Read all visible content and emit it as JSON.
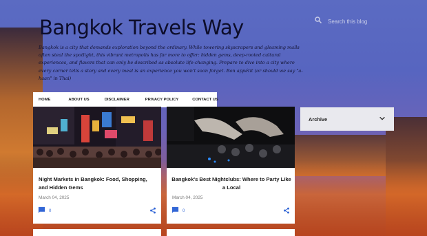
{
  "search": {
    "placeholder": "Search this blog",
    "icon": "search-icon"
  },
  "blog": {
    "title": "Bangkok Travels Way",
    "description": "Bangkok is a city that demands exploration beyond the ordinary. While towering skyscrapers and gleaming malls often steal the spotlight, this vibrant metropolis has far more to offer: hidden gems, deep-rooted cultural experiences, and flavors that can only be described as absolute life-changing. Prepare to dive into a city where every corner tells a story and every meal is an experience you won't soon forget. Bon appétit (or should we say \"a-haan\" in Thai)"
  },
  "nav": {
    "items": [
      {
        "label": "Home"
      },
      {
        "label": "About Us"
      },
      {
        "label": "Disclaimer"
      },
      {
        "label": "Privacy Policy"
      },
      {
        "label": "Contact Us"
      }
    ]
  },
  "posts": [
    {
      "title": "Night Markets in Bangkok: Food, Shopping, and Hidden Gems",
      "date": "March 04, 2025",
      "comments": "0"
    },
    {
      "title": "Bangkok's Best Nightclubs: Where to Party Like a Local",
      "date": "March 04, 2025",
      "comments": "0"
    }
  ],
  "sidebar": {
    "archive_label": "Archive"
  },
  "colors": {
    "accent": "#3367d6",
    "title": "#0d0d2a"
  }
}
